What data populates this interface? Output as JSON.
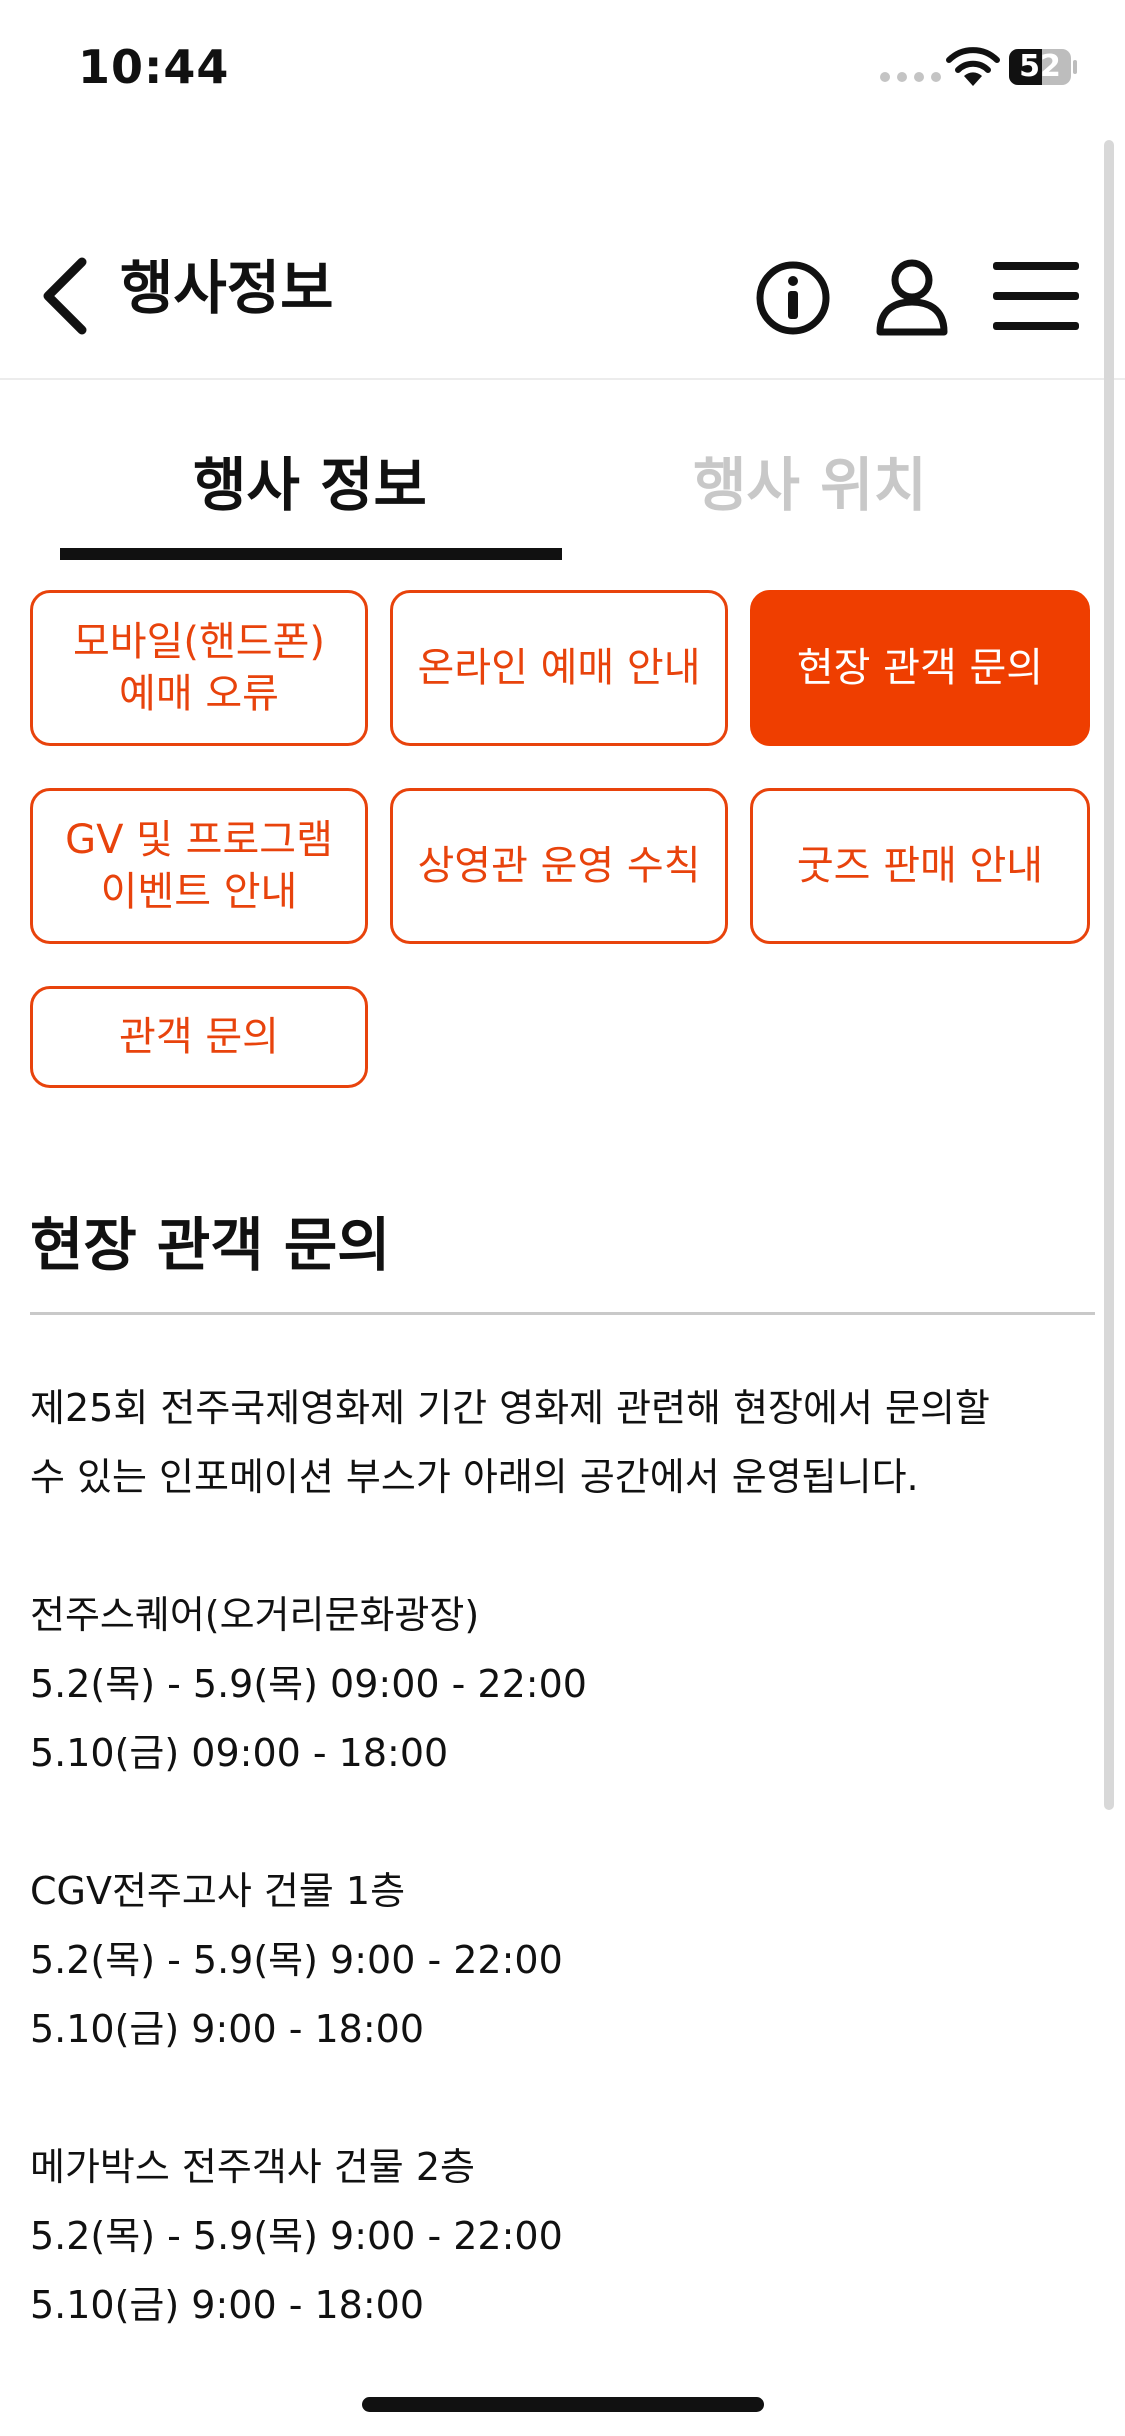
{
  "status_bar": {
    "time": "10:44",
    "battery": "52"
  },
  "header": {
    "title": "행사정보",
    "icons": [
      "back-icon",
      "info-icon",
      "user-icon",
      "menu-icon"
    ]
  },
  "tabs": [
    {
      "label": "행사 정보",
      "active": true
    },
    {
      "label": "행사 위치",
      "active": false
    }
  ],
  "categories": [
    {
      "label": "모바일(핸드폰)\n예매 오류",
      "active": false
    },
    {
      "label": "온라인 예매 안내",
      "active": false
    },
    {
      "label": "현장 관객 문의",
      "active": true
    },
    {
      "label": "GV 및 프로그램\n이벤트 안내",
      "active": false
    },
    {
      "label": "상영관 운영 수칙",
      "active": false
    },
    {
      "label": "굿즈 판매 안내",
      "active": false
    },
    {
      "label": "관객 문의",
      "active": false
    }
  ],
  "section": {
    "title": "현장 관객 문의",
    "intro_line1": "제25회 전주국제영화제 기간 영화제 관련해 현장에서 문의할",
    "intro_line2": "수 있는 인포메이션 부스가 아래의 공간에서 운영됩니다.",
    "locations": [
      {
        "name": "전주스퀘어(오거리문화광장)",
        "hours1": "5.2(목) - 5.9(목) 09:00 - 22:00",
        "hours2": "5.10(금) 09:00 - 18:00"
      },
      {
        "name": "CGV전주고사 건물 1층",
        "hours1": "5.2(목) - 5.9(목) 9:00 - 22:00",
        "hours2": "5.10(금) 9:00 - 18:00"
      },
      {
        "name": "메가박스 전주객사 건물 2층",
        "hours1": "5.2(목) - 5.9(목) 9:00 - 22:00",
        "hours2": "5.10(금) 9:00 - 18:00"
      }
    ]
  },
  "colors": {
    "accent": "#ef3e00",
    "accent_border": "#e8430c",
    "inactive_tab": "#c8c8c8"
  }
}
